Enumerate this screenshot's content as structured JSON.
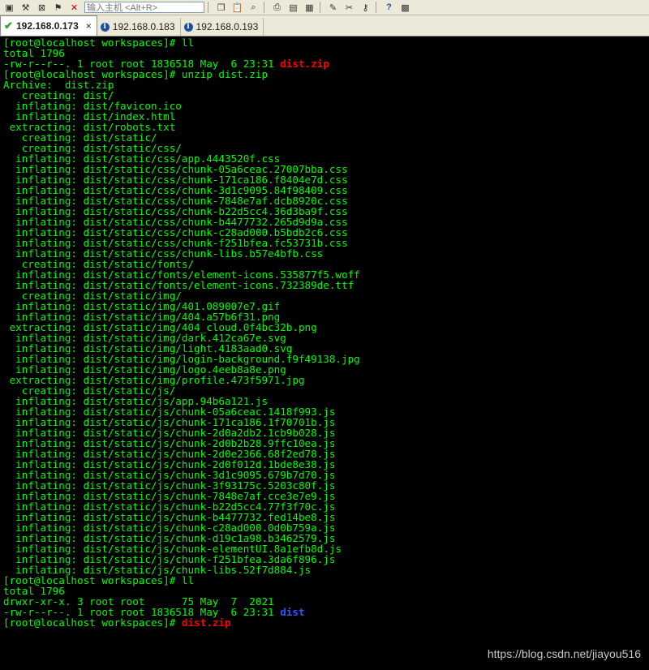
{
  "toolbar": {
    "host_placeholder": "输入主机 <Alt+R>"
  },
  "tabs": [
    {
      "label": "192.168.0.173",
      "status": "connected",
      "close": "×"
    },
    {
      "label": "192.168.0.183",
      "status": "info"
    },
    {
      "label": "192.168.0.193",
      "status": "info"
    }
  ],
  "terminal": {
    "colors": {
      "text": "#00ff00",
      "zip": "#ff0000",
      "dir": "#3355ff",
      "background": "#000000"
    },
    "lines": [
      "[root@localhost workspaces]# ll",
      "total 1796",
      "-rw-r--r--. 1 root root 1836518 May  6 23:31 ",
      "[root@localhost workspaces]# unzip dist.zip",
      "Archive:  dist.zip",
      "   creating: dist/",
      "  inflating: dist/favicon.ico",
      "  inflating: dist/index.html",
      " extracting: dist/robots.txt",
      "   creating: dist/static/",
      "   creating: dist/static/css/",
      "  inflating: dist/static/css/app.4443520f.css",
      "  inflating: dist/static/css/chunk-05a6ceac.27007bba.css",
      "  inflating: dist/static/css/chunk-171ca186.f8404e7d.css",
      "  inflating: dist/static/css/chunk-3d1c9095.84f98409.css",
      "  inflating: dist/static/css/chunk-7848e7af.dcb8920c.css",
      "  inflating: dist/static/css/chunk-b22d5cc4.36d3ba9f.css",
      "  inflating: dist/static/css/chunk-b4477732.265d9d9a.css",
      "  inflating: dist/static/css/chunk-c28ad000.b5bdb2c6.css",
      "  inflating: dist/static/css/chunk-f251bfea.fc53731b.css",
      "  inflating: dist/static/css/chunk-libs.b57e4bfb.css",
      "   creating: dist/static/fonts/",
      "  inflating: dist/static/fonts/element-icons.535877f5.woff",
      "  inflating: dist/static/fonts/element-icons.732389de.ttf",
      "   creating: dist/static/img/",
      "  inflating: dist/static/img/401.089007e7.gif",
      "  inflating: dist/static/img/404.a57b6f31.png",
      " extracting: dist/static/img/404_cloud.0f4bc32b.png",
      "  inflating: dist/static/img/dark.412ca67e.svg",
      "  inflating: dist/static/img/light.4183aad0.svg",
      "  inflating: dist/static/img/login-background.f9f49138.jpg",
      "  inflating: dist/static/img/logo.4eeb8a8e.png",
      " extracting: dist/static/img/profile.473f5971.jpg",
      "   creating: dist/static/js/",
      "  inflating: dist/static/js/app.94b6a121.js",
      "  inflating: dist/static/js/chunk-05a6ceac.1418f993.js",
      "  inflating: dist/static/js/chunk-171ca186.1f70701b.js",
      "  inflating: dist/static/js/chunk-2d0a2db2.1cb9b028.js",
      "  inflating: dist/static/js/chunk-2d0b2b28.9ffc10ea.js",
      "  inflating: dist/static/js/chunk-2d0e2366.68f2ed78.js",
      "  inflating: dist/static/js/chunk-2d0f012d.1bde8e38.js",
      "  inflating: dist/static/js/chunk-3d1c9095.679b7d70.js",
      "  inflating: dist/static/js/chunk-3f93175c.5203c80f.js",
      "  inflating: dist/static/js/chunk-7848e7af.cce3e7e9.js",
      "  inflating: dist/static/js/chunk-b22d5cc4.77f3f70c.js",
      "  inflating: dist/static/js/chunk-b4477732.fed14be8.js",
      "  inflating: dist/static/js/chunk-c28ad000.0d0b759a.js",
      "  inflating: dist/static/js/chunk-d19c1a98.b3462579.js",
      "  inflating: dist/static/js/chunk-elementUI.8a1efb8d.js",
      "  inflating: dist/static/js/chunk-f251bfea.3da6f896.js",
      "  inflating: dist/static/js/chunk-libs.52f7d884.js",
      "[root@localhost workspaces]# ll",
      "total 1796",
      "drwxr-xr-x. 3 root root      75 May  7  2021 ",
      "-rw-r--r--. 1 root root 1836518 May  6 23:31 ",
      "[root@localhost workspaces]# "
    ],
    "highlights": [
      {
        "line": 2,
        "text": "dist.zip",
        "kind": "zip"
      },
      {
        "line": 54,
        "text": "dist",
        "kind": "dir"
      },
      {
        "line": 55,
        "text": "dist.zip",
        "kind": "zip"
      }
    ]
  },
  "watermark": "https://blog.csdn.net/jiayou516"
}
